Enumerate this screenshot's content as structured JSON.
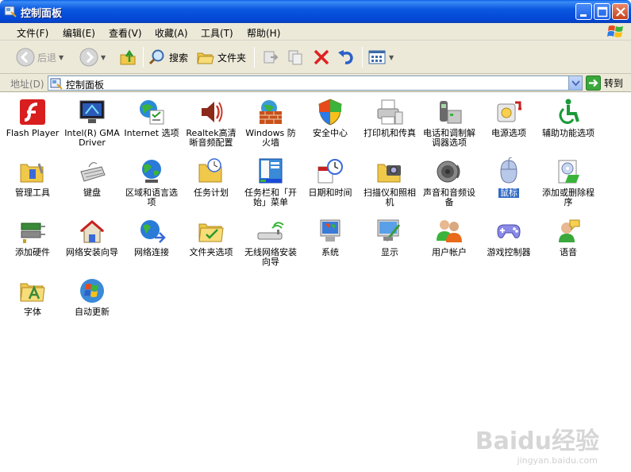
{
  "window": {
    "title": "控制面板"
  },
  "menu": [
    "文件(F)",
    "编辑(E)",
    "查看(V)",
    "收藏(A)",
    "工具(T)",
    "帮助(H)"
  ],
  "toolbar": {
    "back": "后退",
    "search": "搜索",
    "folders": "文件夹"
  },
  "address": {
    "label": "地址(D)",
    "value": "控制面板",
    "go": "转到"
  },
  "items": [
    {
      "label": "Flash Player",
      "icon": "flash-icon"
    },
    {
      "label": "Intel(R) GMA Driver",
      "icon": "monitor-driver-icon"
    },
    {
      "label": "Internet 选项",
      "icon": "internet-options-icon"
    },
    {
      "label": "Realtek高清晰音频配置",
      "icon": "speaker-icon"
    },
    {
      "label": "Windows 防火墙",
      "icon": "firewall-icon"
    },
    {
      "label": "安全中心",
      "icon": "shield-icon"
    },
    {
      "label": "打印机和传真",
      "icon": "printer-icon"
    },
    {
      "label": "电话和调制解调器选项",
      "icon": "phone-icon"
    },
    {
      "label": "电源选项",
      "icon": "power-icon"
    },
    {
      "label": "辅助功能选项",
      "icon": "accessibility-icon"
    },
    {
      "label": "管理工具",
      "icon": "admin-tools-icon"
    },
    {
      "label": "键盘",
      "icon": "keyboard-icon"
    },
    {
      "label": "区域和语言选项",
      "icon": "globe-icon"
    },
    {
      "label": "任务计划",
      "icon": "scheduled-tasks-icon"
    },
    {
      "label": "任务栏和「开始」菜单",
      "icon": "taskbar-icon"
    },
    {
      "label": "日期和时间",
      "icon": "clock-icon"
    },
    {
      "label": "扫描仪和照相机",
      "icon": "scanner-camera-icon"
    },
    {
      "label": "声音和音频设备",
      "icon": "sound-icon"
    },
    {
      "label": "鼠标",
      "icon": "mouse-icon"
    },
    {
      "label": "添加或删除程序",
      "icon": "add-remove-programs-icon"
    },
    {
      "label": "添加硬件",
      "icon": "add-hardware-icon"
    },
    {
      "label": "网络安装向导",
      "icon": "network-setup-icon"
    },
    {
      "label": "网络连接",
      "icon": "network-connections-icon"
    },
    {
      "label": "文件夹选项",
      "icon": "folder-options-icon"
    },
    {
      "label": "无线网络安装向导",
      "icon": "wireless-icon"
    },
    {
      "label": "系统",
      "icon": "system-icon"
    },
    {
      "label": "显示",
      "icon": "display-icon"
    },
    {
      "label": "用户帐户",
      "icon": "user-accounts-icon"
    },
    {
      "label": "游戏控制器",
      "icon": "game-controller-icon"
    },
    {
      "label": "语音",
      "icon": "speech-icon"
    },
    {
      "label": "字体",
      "icon": "fonts-icon"
    },
    {
      "label": "自动更新",
      "icon": "windows-update-icon"
    }
  ],
  "selected_item": "鼠标",
  "watermark": {
    "text": "Baidu经验",
    "sub": "jingyan.baidu.com"
  }
}
